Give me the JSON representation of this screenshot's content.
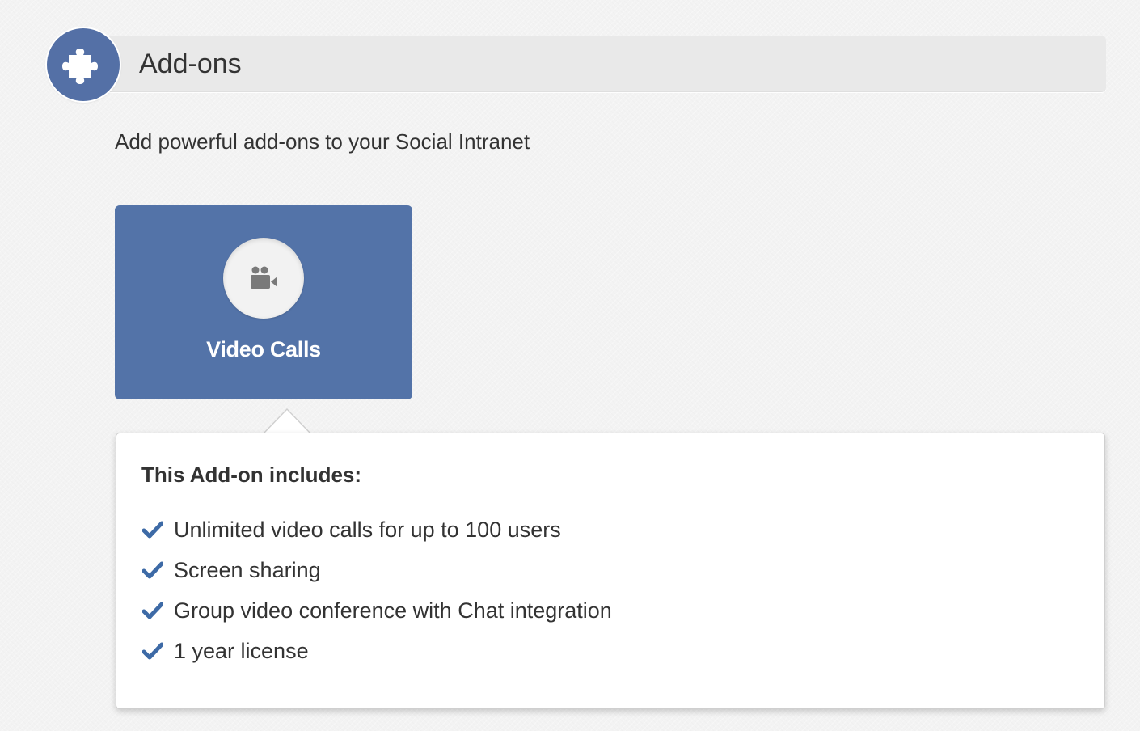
{
  "header": {
    "title": "Add-ons",
    "icon": "puzzle-piece-icon",
    "accent_color": "#5470a6"
  },
  "subtitle": "Add powerful add-ons to your Social Intranet",
  "addons": [
    {
      "title": "Video Calls",
      "icon": "video-camera-icon",
      "color": "#5373a8"
    }
  ],
  "details": {
    "heading": "This Add-on includes:",
    "check_icon": "check-icon",
    "check_color": "#3d6aa6",
    "features": [
      "Unlimited video calls for up to 100 users",
      "Screen sharing",
      "Group video conference with Chat integration",
      "1 year license"
    ]
  }
}
